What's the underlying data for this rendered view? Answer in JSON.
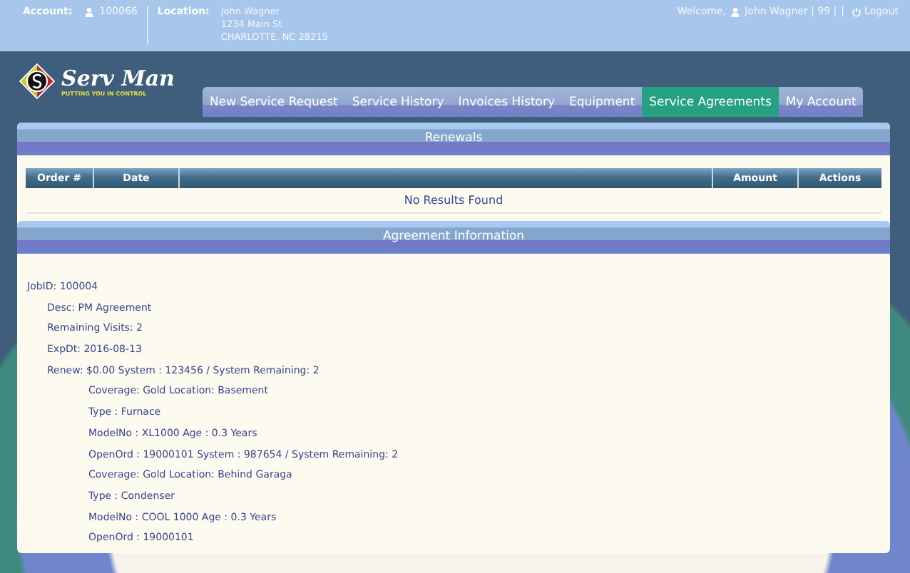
{
  "top_bar": {
    "account_label": "Account:",
    "account_number": "100066",
    "location_label": "Location:",
    "location_lines": [
      "John Wagner",
      "1234 Main St",
      "CHARLOTTE, NC 28215"
    ],
    "welcome": "Welcome,",
    "user": "John Wagner | 99 |",
    "separator": "|",
    "logout": "Logout"
  },
  "logo": {
    "name": "Serv Man",
    "tagline": "PUTTING YOU IN CONTROL"
  },
  "tabs": [
    {
      "label": "New Service Request",
      "selected": false
    },
    {
      "label": "Service History",
      "selected": false
    },
    {
      "label": "Invoices History",
      "selected": false
    },
    {
      "label": "Equipment",
      "selected": false
    },
    {
      "label": "Service Agreements",
      "selected": true
    },
    {
      "label": "My Account",
      "selected": false
    }
  ],
  "renewals": {
    "title": "Renewals",
    "table": {
      "columns": [
        "Order #",
        "Date",
        "",
        "Amount",
        "Actions"
      ],
      "empty_message": "No Results Found"
    }
  },
  "agreement": {
    "title": "Agreement Information",
    "lines": [
      {
        "text": "JobID: 100004",
        "children": [
          {
            "text": "Desc: PM Agreement"
          },
          {
            "text": "Remaining Visits: 2"
          },
          {
            "text": "ExpDt: 2016-08-13"
          },
          {
            "text": "Renew: $0.00 System : 123456 / System Remaining: 2",
            "children": [
              {
                "text": "Coverage: Gold Location: Basement"
              },
              {
                "text": "Type : Furnace"
              },
              {
                "text": "ModelNo : XL1000 Age : 0.3 Years"
              },
              {
                "text": "OpenOrd : 19000101 System : 987654 / System Remaining: 2"
              },
              {
                "text": "Coverage: Gold Location: Behind Garaga"
              },
              {
                "text": "Type : Condenser"
              },
              {
                "text": "ModelNo : COOL 1000 Age : 0.3 Years"
              },
              {
                "text": "OpenOrd : 19000101"
              }
            ]
          }
        ]
      }
    ]
  }
}
